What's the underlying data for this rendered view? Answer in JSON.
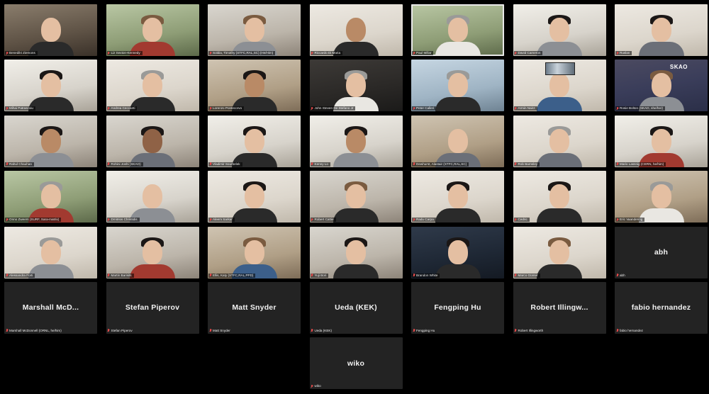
{
  "participants": [
    {
      "name": "Benedikt Ziemons",
      "video": true,
      "bg": "bg-c",
      "look": "skin-2 hair-0 shirt-7"
    },
    {
      "name": "Liz Sexton-Kennedy",
      "video": true,
      "bg": "bg-f",
      "look": "skin-2 hair-3 shirt-3"
    },
    {
      "name": "Soldia, Timothy (STFC,RAL,SC) (He/Him)",
      "video": true,
      "bg": "bg-a",
      "look": "skin-2 hair-3 shirt-6"
    },
    {
      "name": "Riccardo Di Maria",
      "video": true,
      "bg": "bg-h",
      "look": "skin-3 hair-0 shirt-7"
    },
    {
      "name": "Paul Millar",
      "video": true,
      "bg": "bg-f",
      "look": "skin-2 hair-4 shirt-4",
      "active": true
    },
    {
      "name": "David Cameron",
      "video": true,
      "bg": "bg-b",
      "look": "skin-2 hair-2 shirt-6"
    },
    {
      "name": "Ruslan",
      "video": true,
      "bg": "bg-h",
      "look": "skin-2 hair-2 shirt-2"
    },
    {
      "name": "Mihai Patrascoiu",
      "video": true,
      "bg": "bg-b",
      "look": "skin-2 hair-2 shirt-7"
    },
    {
      "name": "Andrea Ceccanti",
      "video": true,
      "bg": "bg-h",
      "look": "skin-2 hair-4 shirt-7"
    },
    {
      "name": "Lorenzo Pontecorvo",
      "video": true,
      "bg": "bg-j",
      "look": "skin-3 hair-2 shirt-7"
    },
    {
      "name": "John Steven De Stefano Jr",
      "video": true,
      "bg": "bg-e",
      "look": "skin-2 hair-4 shirt-4"
    },
    {
      "name": "Peter Calleri",
      "video": true,
      "bg": "bg-d",
      "look": "skin-2 hair-4 shirt-7"
    },
    {
      "name": "Armin Nairz",
      "video": true,
      "bg": "bg-h",
      "look": "skin-2 hair-0 shirt-5",
      "poster": true
    },
    {
      "name": "Rosie Bolton (SKAO, she/her)",
      "video": true,
      "bg": "bg-g",
      "look": "skin-2 hair-3 shirt-6",
      "logo": "SKAO"
    },
    {
      "name": "Rahul Chauhan",
      "video": true,
      "bg": "bg-a",
      "look": "skin-3 hair-2 shirt-6"
    },
    {
      "name": "Rohini Joshi (SKAO)",
      "video": true,
      "bg": "bg-a",
      "look": "skin-4 hair-2 shirt-2"
    },
    {
      "name": "Vladimir Sourbelek",
      "video": true,
      "bg": "bg-b",
      "look": "skin-2 hair-2 shirt-7"
    },
    {
      "name": "Kenny Lo",
      "video": true,
      "bg": "bg-b",
      "look": "skin-3 hair-2 shirt-6"
    },
    {
      "name": "Dewhurst, Alastair (STFC,RAL,SC)",
      "video": true,
      "bg": "bg-j",
      "look": "skin-2 hair-0 shirt-2"
    },
    {
      "name": "Rob Barnsley",
      "video": true,
      "bg": "bg-h",
      "look": "skin-2 hair-4 shirt-2"
    },
    {
      "name": "Mario Lassnig (CERN, he/him)",
      "video": true,
      "bg": "bg-b",
      "look": "skin-2 hair-2 shirt-3"
    },
    {
      "name": "Onno Zweers (SURF, Sara-matrix)",
      "video": true,
      "bg": "bg-f",
      "look": "skin-2 hair-4 shirt-3"
    },
    {
      "name": "Dmitrios Christidis",
      "video": true,
      "bg": "bg-b",
      "look": "skin-2 hair-0 shirt-6"
    },
    {
      "name": "Aleem Sarkar",
      "video": true,
      "bg": "bg-h",
      "look": "skin-2 hair-2 shirt-7"
    },
    {
      "name": "Robert Cattie",
      "video": true,
      "bg": "bg-a",
      "look": "skin-2 hair-3 shirt-7"
    },
    {
      "name": "Radu Carpa",
      "video": true,
      "bg": "bg-h",
      "look": "skin-2 hair-2 shirt-7"
    },
    {
      "name": "Cedric",
      "video": true,
      "bg": "bg-h",
      "look": "skin-2 hair-2 shirt-7"
    },
    {
      "name": "Eric Vaandering",
      "video": true,
      "bg": "bg-j",
      "look": "skin-2 hair-4 shirt-4"
    },
    {
      "name": "Alessandra Forti",
      "video": true,
      "bg": "bg-h",
      "look": "skin-2 hair-4 shirt-6"
    },
    {
      "name": "Martin Barisits",
      "video": true,
      "bg": "bg-a",
      "look": "skin-2 hair-2 shirt-3"
    },
    {
      "name": "Ellis, Katy (STFC,RAL,PPD)",
      "video": true,
      "bg": "bg-j",
      "look": "skin-2 hair-3 shirt-5"
    },
    {
      "name": "Yuji Bori",
      "video": true,
      "bg": "bg-a",
      "look": "skin-2 hair-2 shirt-7"
    },
    {
      "name": "Brandon White",
      "video": true,
      "bg": "bg-i",
      "look": "skin-2 hair-2 shirt-7"
    },
    {
      "name": "Marco Günter",
      "video": true,
      "bg": "bg-h",
      "look": "skin-2 hair-3 shirt-7"
    },
    {
      "name": "abh",
      "video": false,
      "display": "abh"
    },
    {
      "name": "Marshall McDonnell (ORNL, he/him)",
      "video": false,
      "display": "Marshall McD..."
    },
    {
      "name": "Stefan Piperov",
      "video": false,
      "display": "Stefan Piperov"
    },
    {
      "name": "Matt Snyder",
      "video": false,
      "display": "Matt Snyder"
    },
    {
      "name": "Ueda (KEK)",
      "video": false,
      "display": "Ueda (KEK)"
    },
    {
      "name": "Fengping Hu",
      "video": false,
      "display": "Fengping Hu"
    },
    {
      "name": "Robert Illingworth",
      "video": false,
      "display": "Robert Illingw..."
    },
    {
      "name": "fabio hernandez",
      "video": false,
      "display": "fabio hernandez"
    },
    {
      "name": "wiko",
      "video": false,
      "display": "wiko",
      "col": 4
    }
  ]
}
